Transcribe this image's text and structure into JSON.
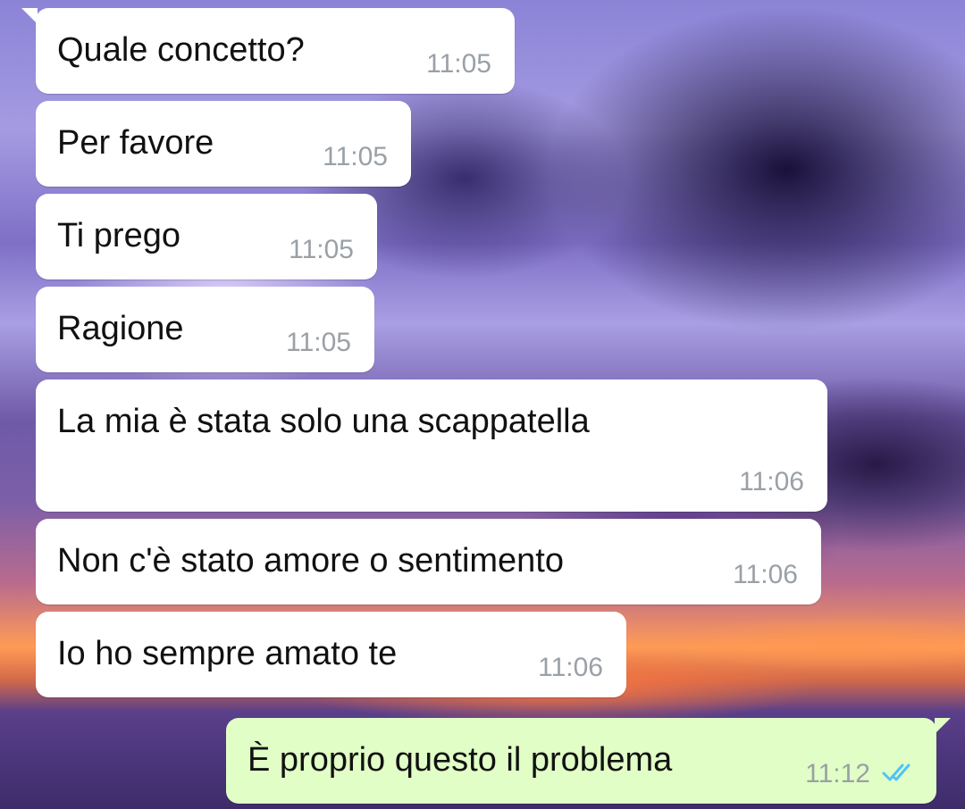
{
  "messages": [
    {
      "text": "Quale concetto?",
      "time": "11:05",
      "direction": "incoming"
    },
    {
      "text": "Per favore",
      "time": "11:05",
      "direction": "incoming"
    },
    {
      "text": "Ti prego",
      "time": "11:05",
      "direction": "incoming"
    },
    {
      "text": "Ragione",
      "time": "11:05",
      "direction": "incoming"
    },
    {
      "text": "La mia è stata solo una scappatella",
      "time": "11:06",
      "direction": "incoming"
    },
    {
      "text": "Non c'è stato amore o sentimento",
      "time": "11:06",
      "direction": "incoming"
    },
    {
      "text": "Io ho sempre amato te",
      "time": "11:06",
      "direction": "incoming"
    },
    {
      "text": "È proprio questo il problema",
      "time": "11:12",
      "direction": "outgoing",
      "status": "read",
      "status_icon": "double-check-icon"
    }
  ],
  "colors": {
    "incoming_bubble": "#ffffff",
    "outgoing_bubble": "#e1fec6",
    "timestamp": "#9aa0a6",
    "read_ticks": "#4fc3f7"
  }
}
